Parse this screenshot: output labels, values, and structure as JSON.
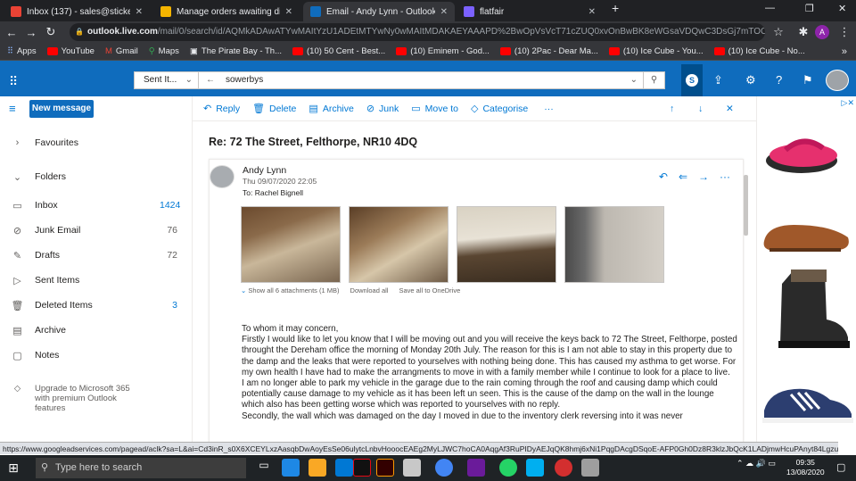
{
  "browser": {
    "tabs": [
      {
        "title": "Inbox (137) - sales@stickerpro.in",
        "favicon_color": "#ea4335"
      },
      {
        "title": "Manage orders awaiting dispatch",
        "favicon_color": "#f4b400"
      },
      {
        "title": "Email - Andy Lynn - Outlook",
        "favicon_color": "#0f6cbd"
      },
      {
        "title": "flatfair",
        "favicon_color": "#7b61ff"
      }
    ],
    "url_host": "outlook.live.com",
    "url_path": "/mail/0/search/id/AQMkADAwATYwMAItYzU1ADEtMTYwNy0wMAItMDAKAEYAAAPD%2BwOpVsVcT71cZUQ0xvOnBwBK8eWGsaVDQwC3DsGj7mTOCw...",
    "bookmarks": [
      {
        "label": "Apps",
        "type": "apps"
      },
      {
        "label": "YouTube",
        "type": "yt"
      },
      {
        "label": "Gmail",
        "type": "gmail"
      },
      {
        "label": "Maps",
        "type": "maps"
      },
      {
        "label": "The Pirate Bay - Th...",
        "type": "page"
      },
      {
        "label": "(10) 50 Cent - Best...",
        "type": "yt"
      },
      {
        "label": "(10) Eminem - God...",
        "type": "yt"
      },
      {
        "label": "(10) 2Pac - Dear Ma...",
        "type": "yt"
      },
      {
        "label": "(10) Ice Cube - You...",
        "type": "yt"
      },
      {
        "label": "(10) Ice Cube - No...",
        "type": "yt"
      }
    ]
  },
  "outlook": {
    "search_scope": "Sent It...",
    "search_query": "sowerbys",
    "new_message": "New message",
    "favourites": "Favourites",
    "folders_header": "Folders",
    "folders": [
      {
        "label": "Inbox",
        "count": "1424",
        "highlight": true,
        "icon": "inbox-icon",
        "glyph": "▭"
      },
      {
        "label": "Junk Email",
        "count": "76",
        "highlight": false,
        "icon": "junk-icon",
        "glyph": "⊘"
      },
      {
        "label": "Drafts",
        "count": "72",
        "highlight": false,
        "icon": "pencil-icon",
        "glyph": "✎"
      },
      {
        "label": "Sent Items",
        "count": "",
        "highlight": false,
        "icon": "send-icon",
        "glyph": "▷"
      },
      {
        "label": "Deleted Items",
        "count": "3",
        "highlight": true,
        "icon": "trash-icon",
        "glyph": "🗑"
      },
      {
        "label": "Archive",
        "count": "",
        "highlight": false,
        "icon": "archive-icon",
        "glyph": "▤"
      },
      {
        "label": "Notes",
        "count": "",
        "highlight": false,
        "icon": "notes-icon",
        "glyph": "▢"
      }
    ],
    "upgrade_text": "Upgrade to Microsoft 365 with premium Outlook features",
    "commands": [
      {
        "label": "Reply",
        "icon": "reply-icon",
        "glyph": "↶"
      },
      {
        "label": "Delete",
        "icon": "trash-icon",
        "glyph": "🗑"
      },
      {
        "label": "Archive",
        "icon": "archive-icon",
        "glyph": "▤"
      },
      {
        "label": "Junk",
        "icon": "junk-icon",
        "glyph": "⊘"
      },
      {
        "label": "Move to",
        "icon": "move-icon",
        "glyph": "▭"
      },
      {
        "label": "Categorise",
        "icon": "tag-icon",
        "glyph": "◇"
      }
    ],
    "subject": "Re: 72 The Street, Felthorpe, NR10 4DQ",
    "sender": "Andy Lynn",
    "date": "Thu 09/07/2020 22:05",
    "to_label": "To:",
    "to": "Rachel Bignell",
    "attachments_summary": "Show all 6 attachments (1 MB)",
    "download_all": "Download all",
    "save_onedrive": "Save all to OneDrive",
    "body": [
      "To whom it may concern,",
      "Firstly I would like to let you know that I will be moving out and you will receive the keys back to 72 The Street, Felthorpe, posted throught the Dereham office the morning of Monday 20th July. The reason for this is I am not able to stay in this property due to the damp and the leaks that were reported to yourselves with nothing being done. This has caused my asthma to get worse. For my own health I have had to make the arrangments to move in with a family member while I continue to look for a place to live.",
      "I am no longer able to park my vehicle in the garage due to the rain coming through the roof and causing damp which could potentially cause damage to my vehicle as it has been left un seen. This is the cause of the damp on the wall in the lounge which also has been getting worse which was reported to yourselves with no reply.",
      "Secondly, the wall which was damaged on the day I moved in due to the inventory clerk reversing into it was never"
    ]
  },
  "status_url": "https://www.googleadservices.com/pagead/aclk?sa=L&ai=Cd3inR_s0X6XCEYLxzAasqbDwAoyEsSe06ulytcLnbvHooocEAEg2MyLJWC7hoCA0AqgAf3RuPIDyAEJqQK8hmj6xNi1PqgDAcgDSqoE-AFP0Gh0Dz8R3klzJbQcK1LADjmwHcuPAnyt84LgzuGcJyAI...",
  "taskbar": {
    "search_placeholder": "Type here to search",
    "time": "09:35",
    "date": "13/08/2020"
  }
}
